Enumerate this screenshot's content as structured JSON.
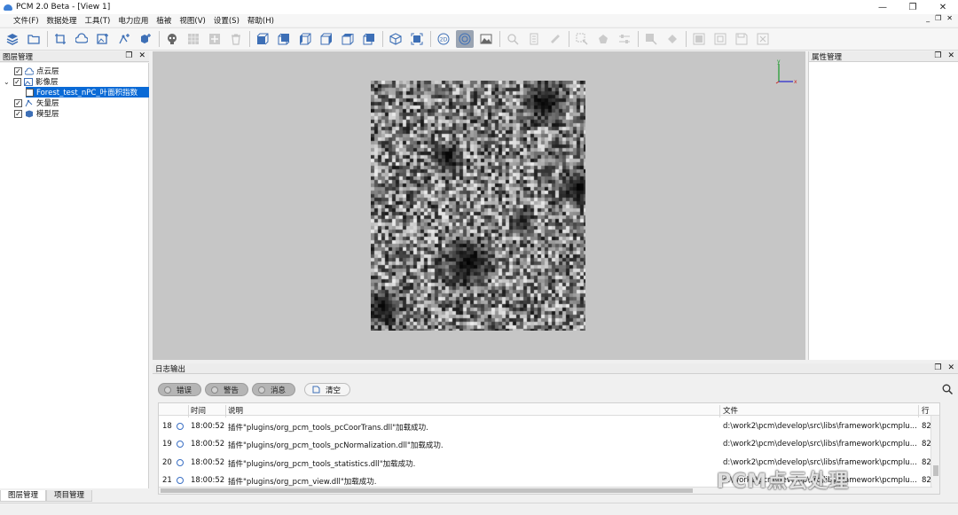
{
  "window": {
    "title": "PCM 2.0 Beta - [View 1]",
    "controls": [
      "—",
      "❐",
      "✕"
    ]
  },
  "menu": {
    "items": [
      "文件(F)",
      "数据处理",
      "工具(T)",
      "电力应用",
      "植被",
      "视图(V)",
      "设置(S)",
      "帮助(H)"
    ],
    "mdi_controls": [
      "_",
      "❐",
      "✕"
    ]
  },
  "toolbar": {
    "active_button": "2d-view"
  },
  "layer_panel": {
    "title": "图层管理",
    "controls": [
      "❐",
      "✕"
    ],
    "tree": [
      {
        "label": "点云层",
        "checked": "✓",
        "icon": "cloud-icon"
      },
      {
        "label": "影像层",
        "checked": "✓",
        "icon": "image-icon",
        "expanded": "⌄"
      },
      {
        "label": "Forest_test_nPC_叶面积指数",
        "checked": "✓",
        "icon": "",
        "selected": true
      },
      {
        "label": "矢量层",
        "checked": "✓",
        "icon": "vector-icon"
      },
      {
        "label": "模型层",
        "checked": "✓",
        "icon": "model-icon"
      }
    ],
    "bottom_tabs": [
      "图层管理",
      "项目管理"
    ]
  },
  "property_panel": {
    "title": "属性管理",
    "controls": [
      "❐",
      "✕"
    ]
  },
  "log_panel": {
    "title": "日志输出",
    "controls": [
      "❐",
      "✕"
    ],
    "filters": [
      "错误",
      "警告",
      "消息"
    ],
    "clear_label": "清空",
    "columns": {
      "time": "时间",
      "desc": "说明",
      "file": "文件",
      "line": "行"
    },
    "rows": [
      {
        "num": "18",
        "time": "18:00:52",
        "desc": "插件\"plugins/org_pcm_tools_pcCoorTrans.dll\"加载成功.",
        "file": "d:\\work2\\pcm\\develop\\src\\libs\\framework\\pcmplu...",
        "line": "82"
      },
      {
        "num": "19",
        "time": "18:00:52",
        "desc": "插件\"plugins/org_pcm_tools_pcNormalization.dll\"加载成功.",
        "file": "d:\\work2\\pcm\\develop\\src\\libs\\framework\\pcmplu...",
        "line": "82"
      },
      {
        "num": "20",
        "time": "18:00:52",
        "desc": "插件\"plugins/org_pcm_tools_statistics.dll\"加载成功.",
        "file": "d:\\work2\\pcm\\develop\\src\\libs\\framework\\pcmplu...",
        "line": "82"
      },
      {
        "num": "21",
        "time": "18:00:52",
        "desc": "插件\"plugins/org_pcm_view.dll\"加载成功.",
        "file": "d:\\work2\\pcm\\develop\\src\\libs\\framework\\pcmplu...",
        "line": "82"
      }
    ]
  },
  "viewport": {
    "axes": {
      "y_label": "y",
      "x_label": "x"
    }
  },
  "watermark": {
    "text": "PCM点云处理"
  },
  "colors": {
    "accent": "#0a6ad6",
    "toolbar_icon": "#3d6fb6"
  }
}
